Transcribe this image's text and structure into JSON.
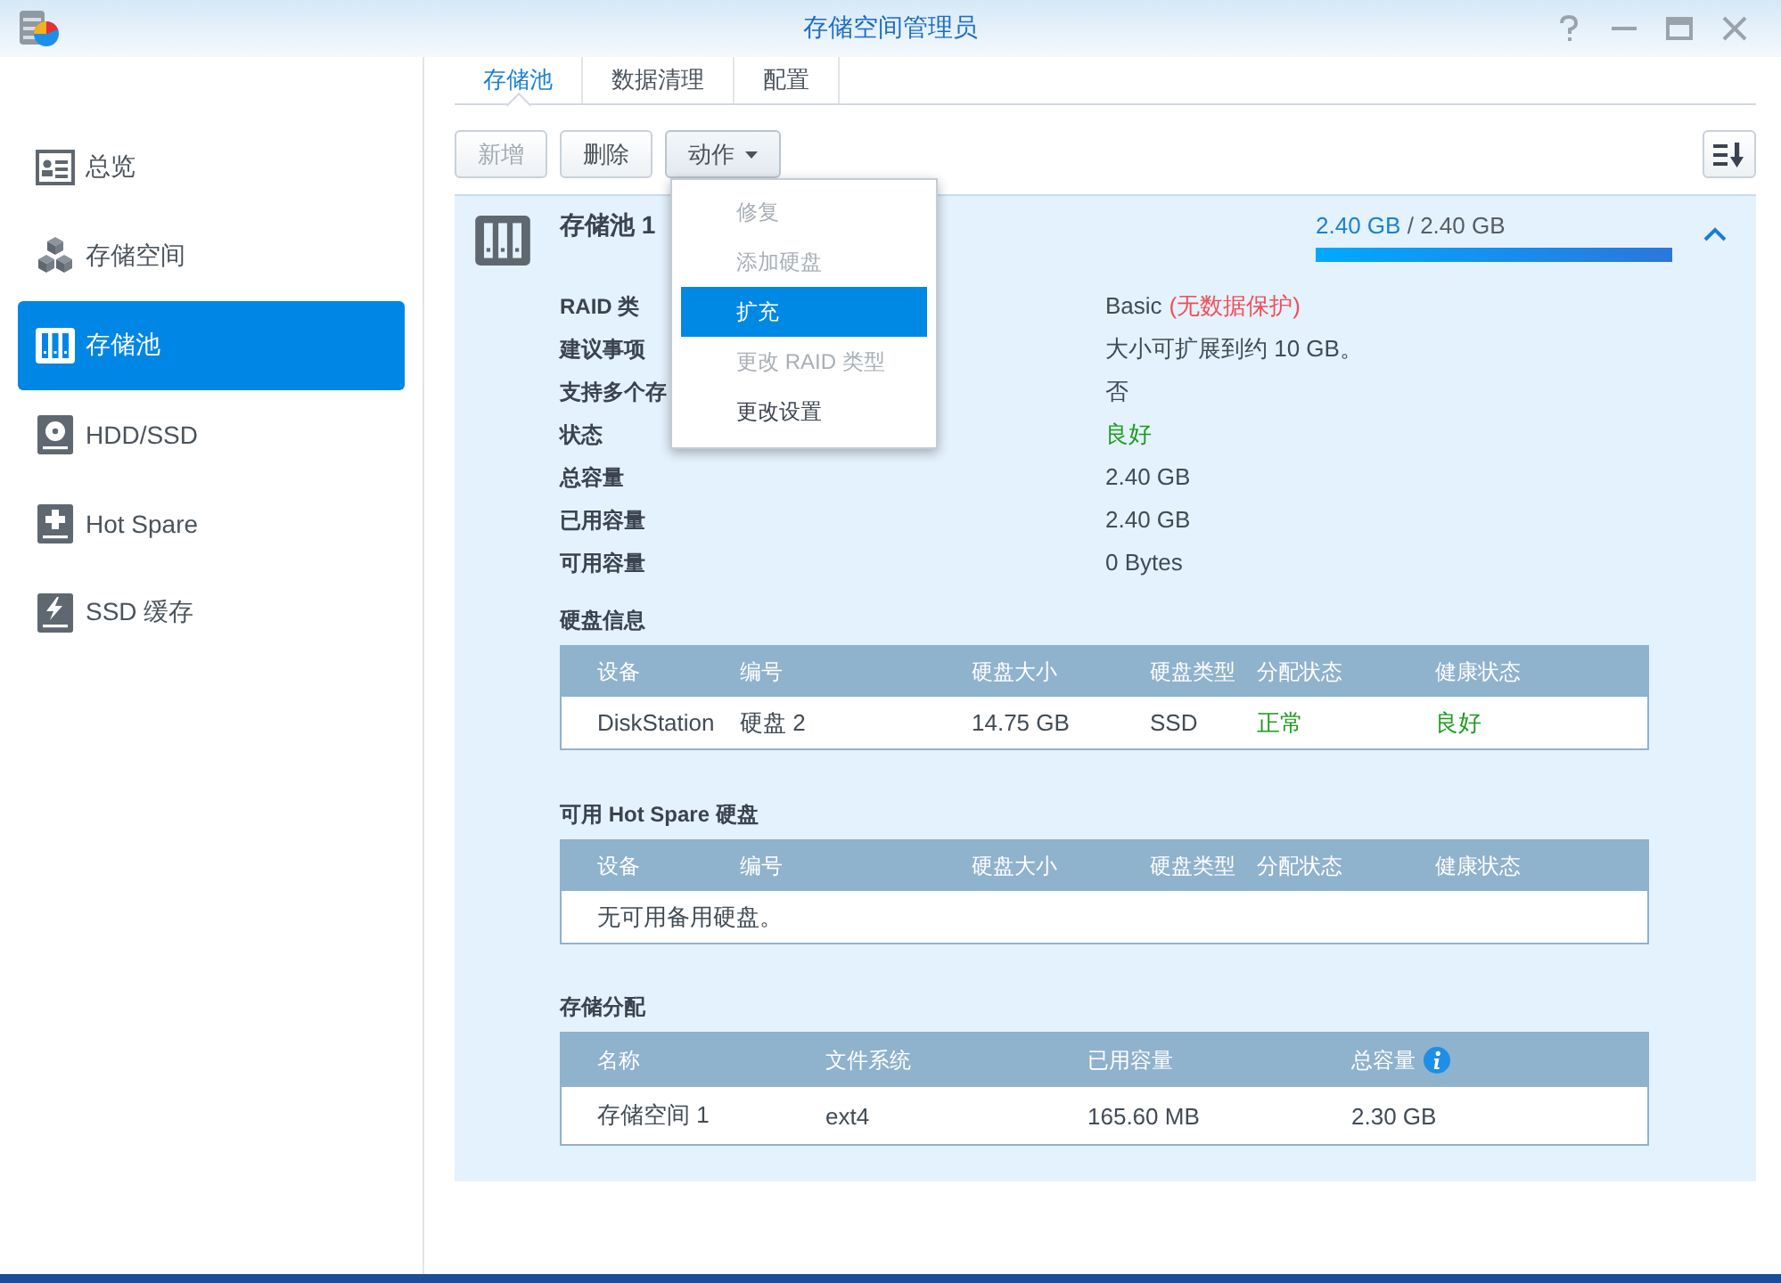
{
  "window": {
    "title": "存储空间管理员"
  },
  "sidebar": {
    "items": [
      {
        "label": "总览",
        "selected": false
      },
      {
        "label": "存储空间",
        "selected": false
      },
      {
        "label": "存储池",
        "selected": true
      },
      {
        "label": "HDD/SSD",
        "selected": false
      },
      {
        "label": "Hot Spare",
        "selected": false
      },
      {
        "label": "SSD 缓存",
        "selected": false
      }
    ]
  },
  "tabs": [
    {
      "label": "存储池",
      "selected": true
    },
    {
      "label": "数据清理",
      "selected": false
    },
    {
      "label": "配置",
      "selected": false
    }
  ],
  "toolbar": {
    "buttons": [
      {
        "label": "新增",
        "kind": "plain",
        "disabled": true,
        "expanded": false
      },
      {
        "label": "删除",
        "kind": "plain",
        "disabled": false,
        "expanded": false
      },
      {
        "label": "动作",
        "kind": "dropdown",
        "disabled": false,
        "expanded": true
      }
    ]
  },
  "action_menu": {
    "items": [
      {
        "label": "修复",
        "disabled": true,
        "selected": false
      },
      {
        "label": "添加硬盘",
        "disabled": true,
        "selected": false
      },
      {
        "label": "扩充",
        "disabled": false,
        "selected": true
      },
      {
        "label": "更改 RAID 类型",
        "disabled": true,
        "selected": false
      },
      {
        "label": "更改设置",
        "disabled": false,
        "selected": false
      }
    ]
  },
  "pool": {
    "title": "存储池 1",
    "expanded": true,
    "usage": {
      "used": "2.40 GB",
      "separator": "/",
      "total": "2.40 GB",
      "level": 1
    },
    "properties": [
      {
        "label": "RAID 类",
        "value": [
          {
            "text": "Basic",
            "color": "#414b55"
          },
          {
            "text": "(无数据保护)",
            "color": "#f24d57"
          }
        ]
      },
      {
        "label": "建议事项",
        "value": [
          {
            "text": "大小可扩展到约 10 GB。",
            "color": "#414b55"
          }
        ]
      },
      {
        "label": "支持多个存",
        "value": [
          {
            "text": "否",
            "color": "#414b55"
          }
        ]
      },
      {
        "label": "状态",
        "value": [
          {
            "text": "良好",
            "color": "#1d9b1d"
          }
        ]
      },
      {
        "label": "总容量",
        "value": [
          {
            "text": "2.40 GB",
            "color": "#414b55"
          }
        ]
      },
      {
        "label": "已用容量",
        "value": [
          {
            "text": "2.40 GB",
            "color": "#414b55"
          }
        ]
      },
      {
        "label": "可用容量",
        "value": [
          {
            "text": "0 Bytes",
            "color": "#414b55"
          }
        ]
      }
    ],
    "disk_info": {
      "title": "硬盘信息",
      "columns": [
        {
          "label": "设备",
          "info": false
        },
        {
          "label": "编号",
          "info": false
        },
        {
          "label": "硬盘大小",
          "info": false
        },
        {
          "label": "硬盘类型",
          "info": false
        },
        {
          "label": "分配状态",
          "info": false
        },
        {
          "label": "健康状态",
          "info": false
        }
      ],
      "rows": [
        [
          {
            "text": "DiskStation",
            "color": "#414b55"
          },
          {
            "text": "硬盘 2",
            "color": "#414b55"
          },
          {
            "text": "14.75 GB",
            "color": "#414b55"
          },
          {
            "text": "SSD",
            "color": "#414b55"
          },
          {
            "text": "正常",
            "color": "#1d9b1d"
          },
          {
            "text": "良好",
            "color": "#1d9b1d"
          }
        ]
      ]
    },
    "hot_spare": {
      "title": "可用 Hot Spare 硬盘",
      "columns": [
        {
          "label": "设备",
          "info": false
        },
        {
          "label": "编号",
          "info": false
        },
        {
          "label": "硬盘大小",
          "info": false
        },
        {
          "label": "硬盘类型",
          "info": false
        },
        {
          "label": "分配状态",
          "info": false
        },
        {
          "label": "健康状态",
          "info": false
        }
      ],
      "empty_message": "无可用备用硬盘。"
    },
    "allocation": {
      "title": "存储分配",
      "columns": [
        {
          "label": "名称",
          "info": false
        },
        {
          "label": "文件系统",
          "info": false
        },
        {
          "label": "已用容量",
          "info": false
        },
        {
          "label": "总容量",
          "info": true
        }
      ],
      "rows": [
        [
          {
            "text": "存储空间 1",
            "color": "#414b55"
          },
          {
            "text": "ext4",
            "color": "#414b55"
          },
          {
            "text": "165.60 MB",
            "color": "#414b55"
          },
          {
            "text": "2.30 GB",
            "color": "#414b55"
          }
        ]
      ]
    }
  }
}
